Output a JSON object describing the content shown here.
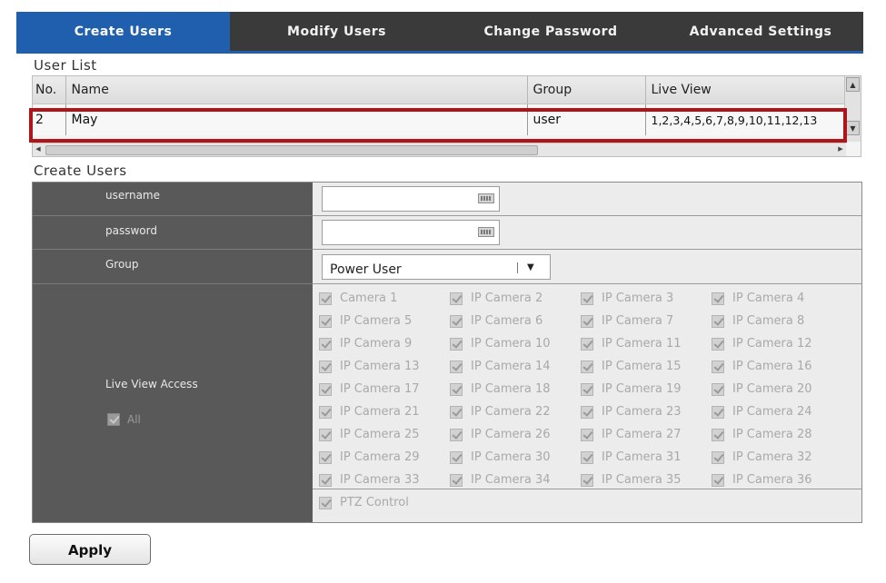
{
  "tabs": [
    {
      "label": "Create Users",
      "active": true
    },
    {
      "label": "Modify Users",
      "active": false
    },
    {
      "label": "Change Password",
      "active": false
    },
    {
      "label": "Advanced Settings",
      "active": false
    }
  ],
  "user_list": {
    "title": "User List",
    "columns": [
      "No.",
      "Name",
      "Group",
      "Live View"
    ],
    "rows": [
      {
        "no": "2",
        "name": "May",
        "group": "user",
        "live_view": "1,2,3,4,5,6,7,8,9,10,11,12,13"
      }
    ]
  },
  "create_users": {
    "title": "Create Users",
    "username_label": "username",
    "username_value": "",
    "password_label": "password",
    "password_value": "",
    "group_label": "Group",
    "group_value": "Power User",
    "live_view_access_label": "Live View Access",
    "all_label": "All",
    "cameras": [
      "Camera 1",
      "IP Camera 2",
      "IP Camera 3",
      "IP Camera 4",
      "IP Camera 5",
      "IP Camera 6",
      "IP Camera 7",
      "IP Camera 8",
      "IP Camera 9",
      "IP Camera 10",
      "IP Camera 11",
      "IP Camera 12",
      "IP Camera 13",
      "IP Camera 14",
      "IP Camera 15",
      "IP Camera 16",
      "IP Camera 17",
      "IP Camera 18",
      "IP Camera 19",
      "IP Camera 20",
      "IP Camera 21",
      "IP Camera 22",
      "IP Camera 23",
      "IP Camera 24",
      "IP Camera 25",
      "IP Camera 26",
      "IP Camera 27",
      "IP Camera 28",
      "IP Camera 29",
      "IP Camera 30",
      "IP Camera 31",
      "IP Camera 32",
      "IP Camera 33",
      "IP Camera 34",
      "IP Camera 35",
      "IP Camera 36"
    ],
    "ptz_label": "PTZ Control"
  },
  "apply_label": "Apply",
  "colors": {
    "accent": "#1f5fae",
    "highlight": "#b0141b",
    "label_bg": "#595959"
  },
  "icons": [
    "keyboard-icon",
    "dropdown-caret-icon",
    "checkbox-checked-icon",
    "scroll-up-icon",
    "scroll-down-icon"
  ]
}
